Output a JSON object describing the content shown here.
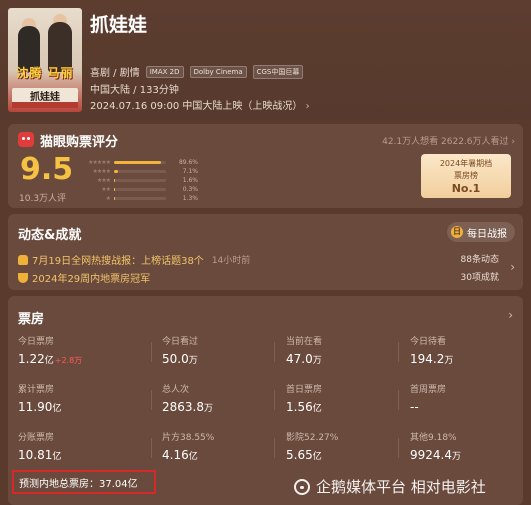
{
  "movie": {
    "title": "抓娃娃",
    "poster": {
      "names": "沈腾 马丽",
      "subtitle": "抓娃娃"
    },
    "genre": "喜剧 / 剧情",
    "tags": [
      "IMAX 2D",
      "Dolby Cinema",
      "CGS中国巨幕"
    ],
    "region_duration": "中国大陆 / 133分钟",
    "release": "2024.07.16 09:00 中国大陆上映（上映战况）"
  },
  "rating": {
    "title": "猫眼购票评分",
    "want": "42.1万人想看 2622.6万人看过",
    "score": "9.5",
    "count": "10.3万人评",
    "distribution": [
      {
        "stars": "★★★★★",
        "pct_label": "89.6%",
        "pct": 89.6
      },
      {
        "stars": "★★★★",
        "pct_label": "7.1%",
        "pct": 7.1
      },
      {
        "stars": "★★★",
        "pct_label": "1.6%",
        "pct": 1.6
      },
      {
        "stars": "★★",
        "pct_label": "0.3%",
        "pct": 0.3
      },
      {
        "stars": "★",
        "pct_label": "1.3%",
        "pct": 1.3
      }
    ],
    "badge": {
      "line1": "2024年暑期档",
      "line2": "票房榜",
      "line3": "No.1"
    }
  },
  "news": {
    "title": "动态&成就",
    "daily_button": "每日战报",
    "item1": "7月19日全网热搜战报：上榜话题38个",
    "item1_time": "14小时前",
    "item2": "2024年29周内地票房冠军",
    "stat1": "88条动态",
    "stat2": "30项成就"
  },
  "boxoffice": {
    "title": "票房",
    "cells": [
      {
        "label": "今日票房",
        "value": "1.22",
        "unit": "亿",
        "delta": "+2.8万"
      },
      {
        "label": "今日看过",
        "value": "50.0",
        "unit": "万"
      },
      {
        "label": "当前在看",
        "value": "47.0",
        "unit": "万"
      },
      {
        "label": "今日待看",
        "value": "194.2",
        "unit": "万"
      },
      {
        "label": "累计票房",
        "value": "11.90",
        "unit": "亿"
      },
      {
        "label": "总人次",
        "value": "2863.8",
        "unit": "万"
      },
      {
        "label": "首日票房",
        "value": "1.56",
        "unit": "亿"
      },
      {
        "label": "首周票房",
        "value": "--",
        "unit": ""
      },
      {
        "label": "分账票房",
        "value": "10.81",
        "unit": "亿"
      },
      {
        "label": "片方38.55%",
        "value": "4.16",
        "unit": "亿"
      },
      {
        "label": "影院52.27%",
        "value": "5.65",
        "unit": "亿"
      },
      {
        "label": "其他9.18%",
        "value": "9924.4",
        "unit": "万"
      }
    ],
    "forecast": "预测内地总票房：37.04亿"
  },
  "watermark": "企鹅媒体平台 相对电影社"
}
